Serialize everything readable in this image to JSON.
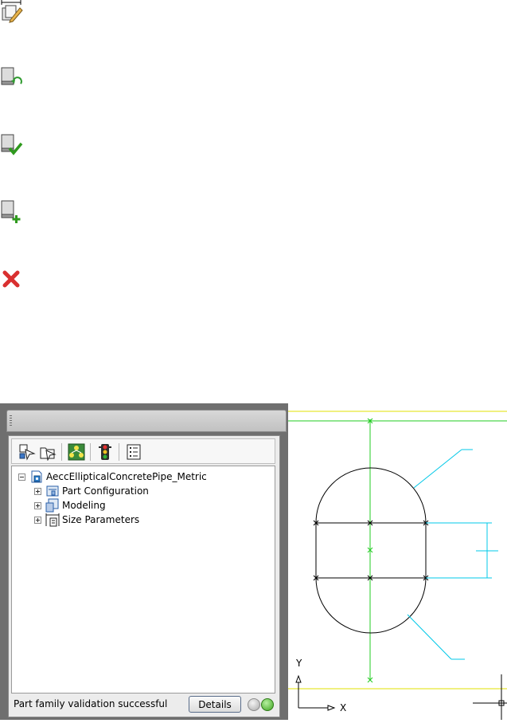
{
  "icon_legend": [
    {
      "icon": "edit-part-icon"
    },
    {
      "icon": "refresh-part-icon"
    },
    {
      "icon": "validate-part-icon"
    },
    {
      "icon": "add-part-icon"
    },
    {
      "icon": "delete-icon"
    }
  ],
  "panel": {
    "toolbar": [
      "new-part-icon",
      "open-part-icon",
      "tree-view-icon",
      "traffic-light-icon",
      "list-icon"
    ],
    "tree": {
      "root": {
        "label": "AeccEllipticalConcretePipe_Metric",
        "icon": "part-family-icon"
      },
      "children": [
        {
          "label": "Part Configuration",
          "icon": "configuration-icon"
        },
        {
          "label": "Modeling",
          "icon": "modeling-icon"
        },
        {
          "label": "Size Parameters",
          "icon": "size-parameters-icon"
        }
      ]
    },
    "status": {
      "message": "Part family validation successful",
      "details_label": "Details"
    }
  },
  "drawing": {
    "ucs": {
      "y_label": "Y",
      "x_label": "X"
    },
    "colors": {
      "boundary": "#e0e000",
      "axis": "#22cc22",
      "dimension": "#00c8e8",
      "geometry": "#000000"
    }
  }
}
